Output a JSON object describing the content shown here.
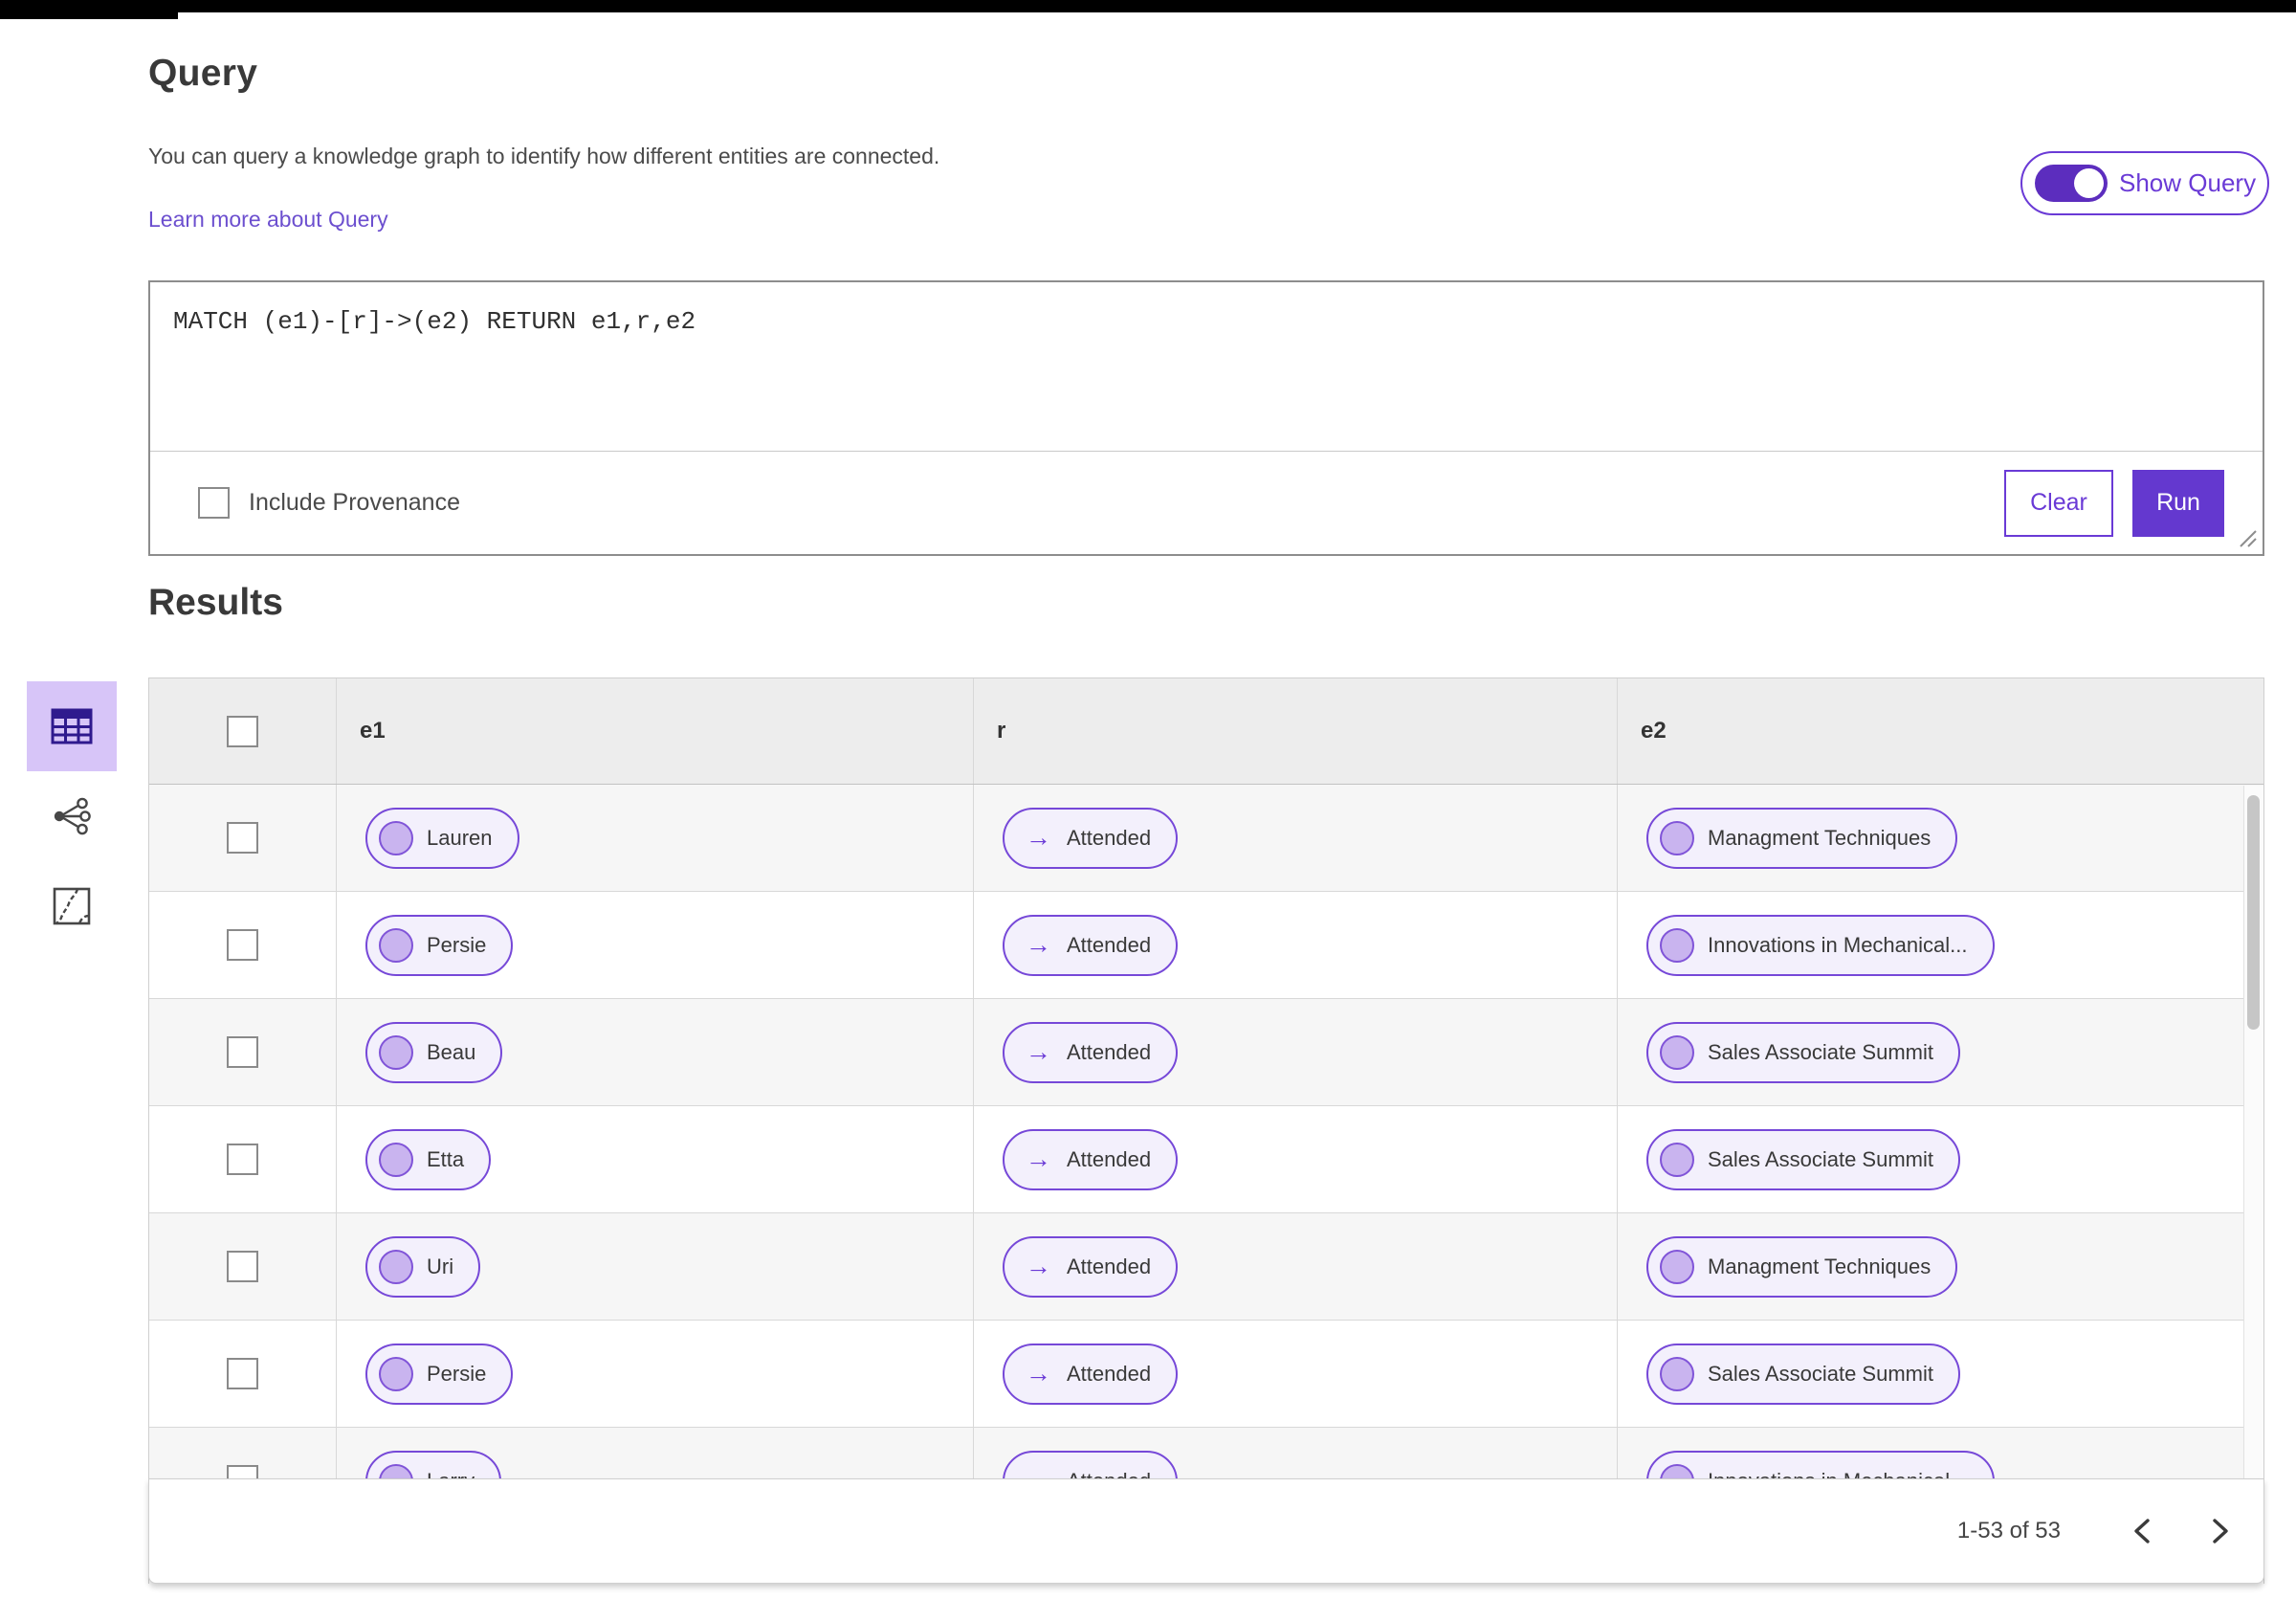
{
  "header": {
    "title": "Query",
    "description": "You can query a knowledge graph to identify how different entities are connected.",
    "learn_more_link": "Learn more about Query",
    "show_query_toggle": {
      "label": "Show Query",
      "state": "on"
    }
  },
  "query_editor": {
    "query_text": "MATCH (e1)-[r]->(e2) RETURN e1,r,e2",
    "include_provenance": {
      "label": "Include Provenance",
      "checked": false
    },
    "clear_button_label": "Clear",
    "run_button_label": "Run"
  },
  "results": {
    "heading": "Results",
    "view_rail": [
      {
        "name": "table-view",
        "selected": true
      },
      {
        "name": "graph-view",
        "selected": false
      },
      {
        "name": "map-view",
        "selected": false
      }
    ],
    "columns": [
      "e1",
      "r",
      "e2"
    ],
    "rows": [
      {
        "e1": "Lauren",
        "r": "Attended",
        "e2": "Managment Techniques"
      },
      {
        "e1": "Persie",
        "r": "Attended",
        "e2": "Innovations in Mechanical..."
      },
      {
        "e1": "Beau",
        "r": "Attended",
        "e2": "Sales Associate Summit"
      },
      {
        "e1": "Etta",
        "r": "Attended",
        "e2": "Sales Associate Summit"
      },
      {
        "e1": "Uri",
        "r": "Attended",
        "e2": "Managment Techniques"
      },
      {
        "e1": "Persie",
        "r": "Attended",
        "e2": "Sales Associate Summit"
      },
      {
        "e1": "Larry",
        "r": "Attended",
        "e2": "Innovations in Mechanical..."
      }
    ],
    "pagination": {
      "range_label": "1-53 of 53",
      "prev_icon": "chevron-left",
      "next_icon": "chevron-right"
    }
  },
  "icons": {
    "relation_arrow": "→",
    "view_rail": [
      "table-grid",
      "share-nodes",
      "map-outline"
    ],
    "resize_handle": "drag-resize"
  },
  "colors": {
    "accent_purple": "#6a3ad6",
    "run_button_fill": "#6438cf",
    "toggle_track": "#5c2dbe",
    "chip_background": "#f3f0fc",
    "chip_border": "#7648d8",
    "avatar_fill": "#c9b4ef",
    "rail_selected_background": "#d7c5f8",
    "table_header_background": "#ededed",
    "row_alternate_background": "#f6f6f6"
  }
}
